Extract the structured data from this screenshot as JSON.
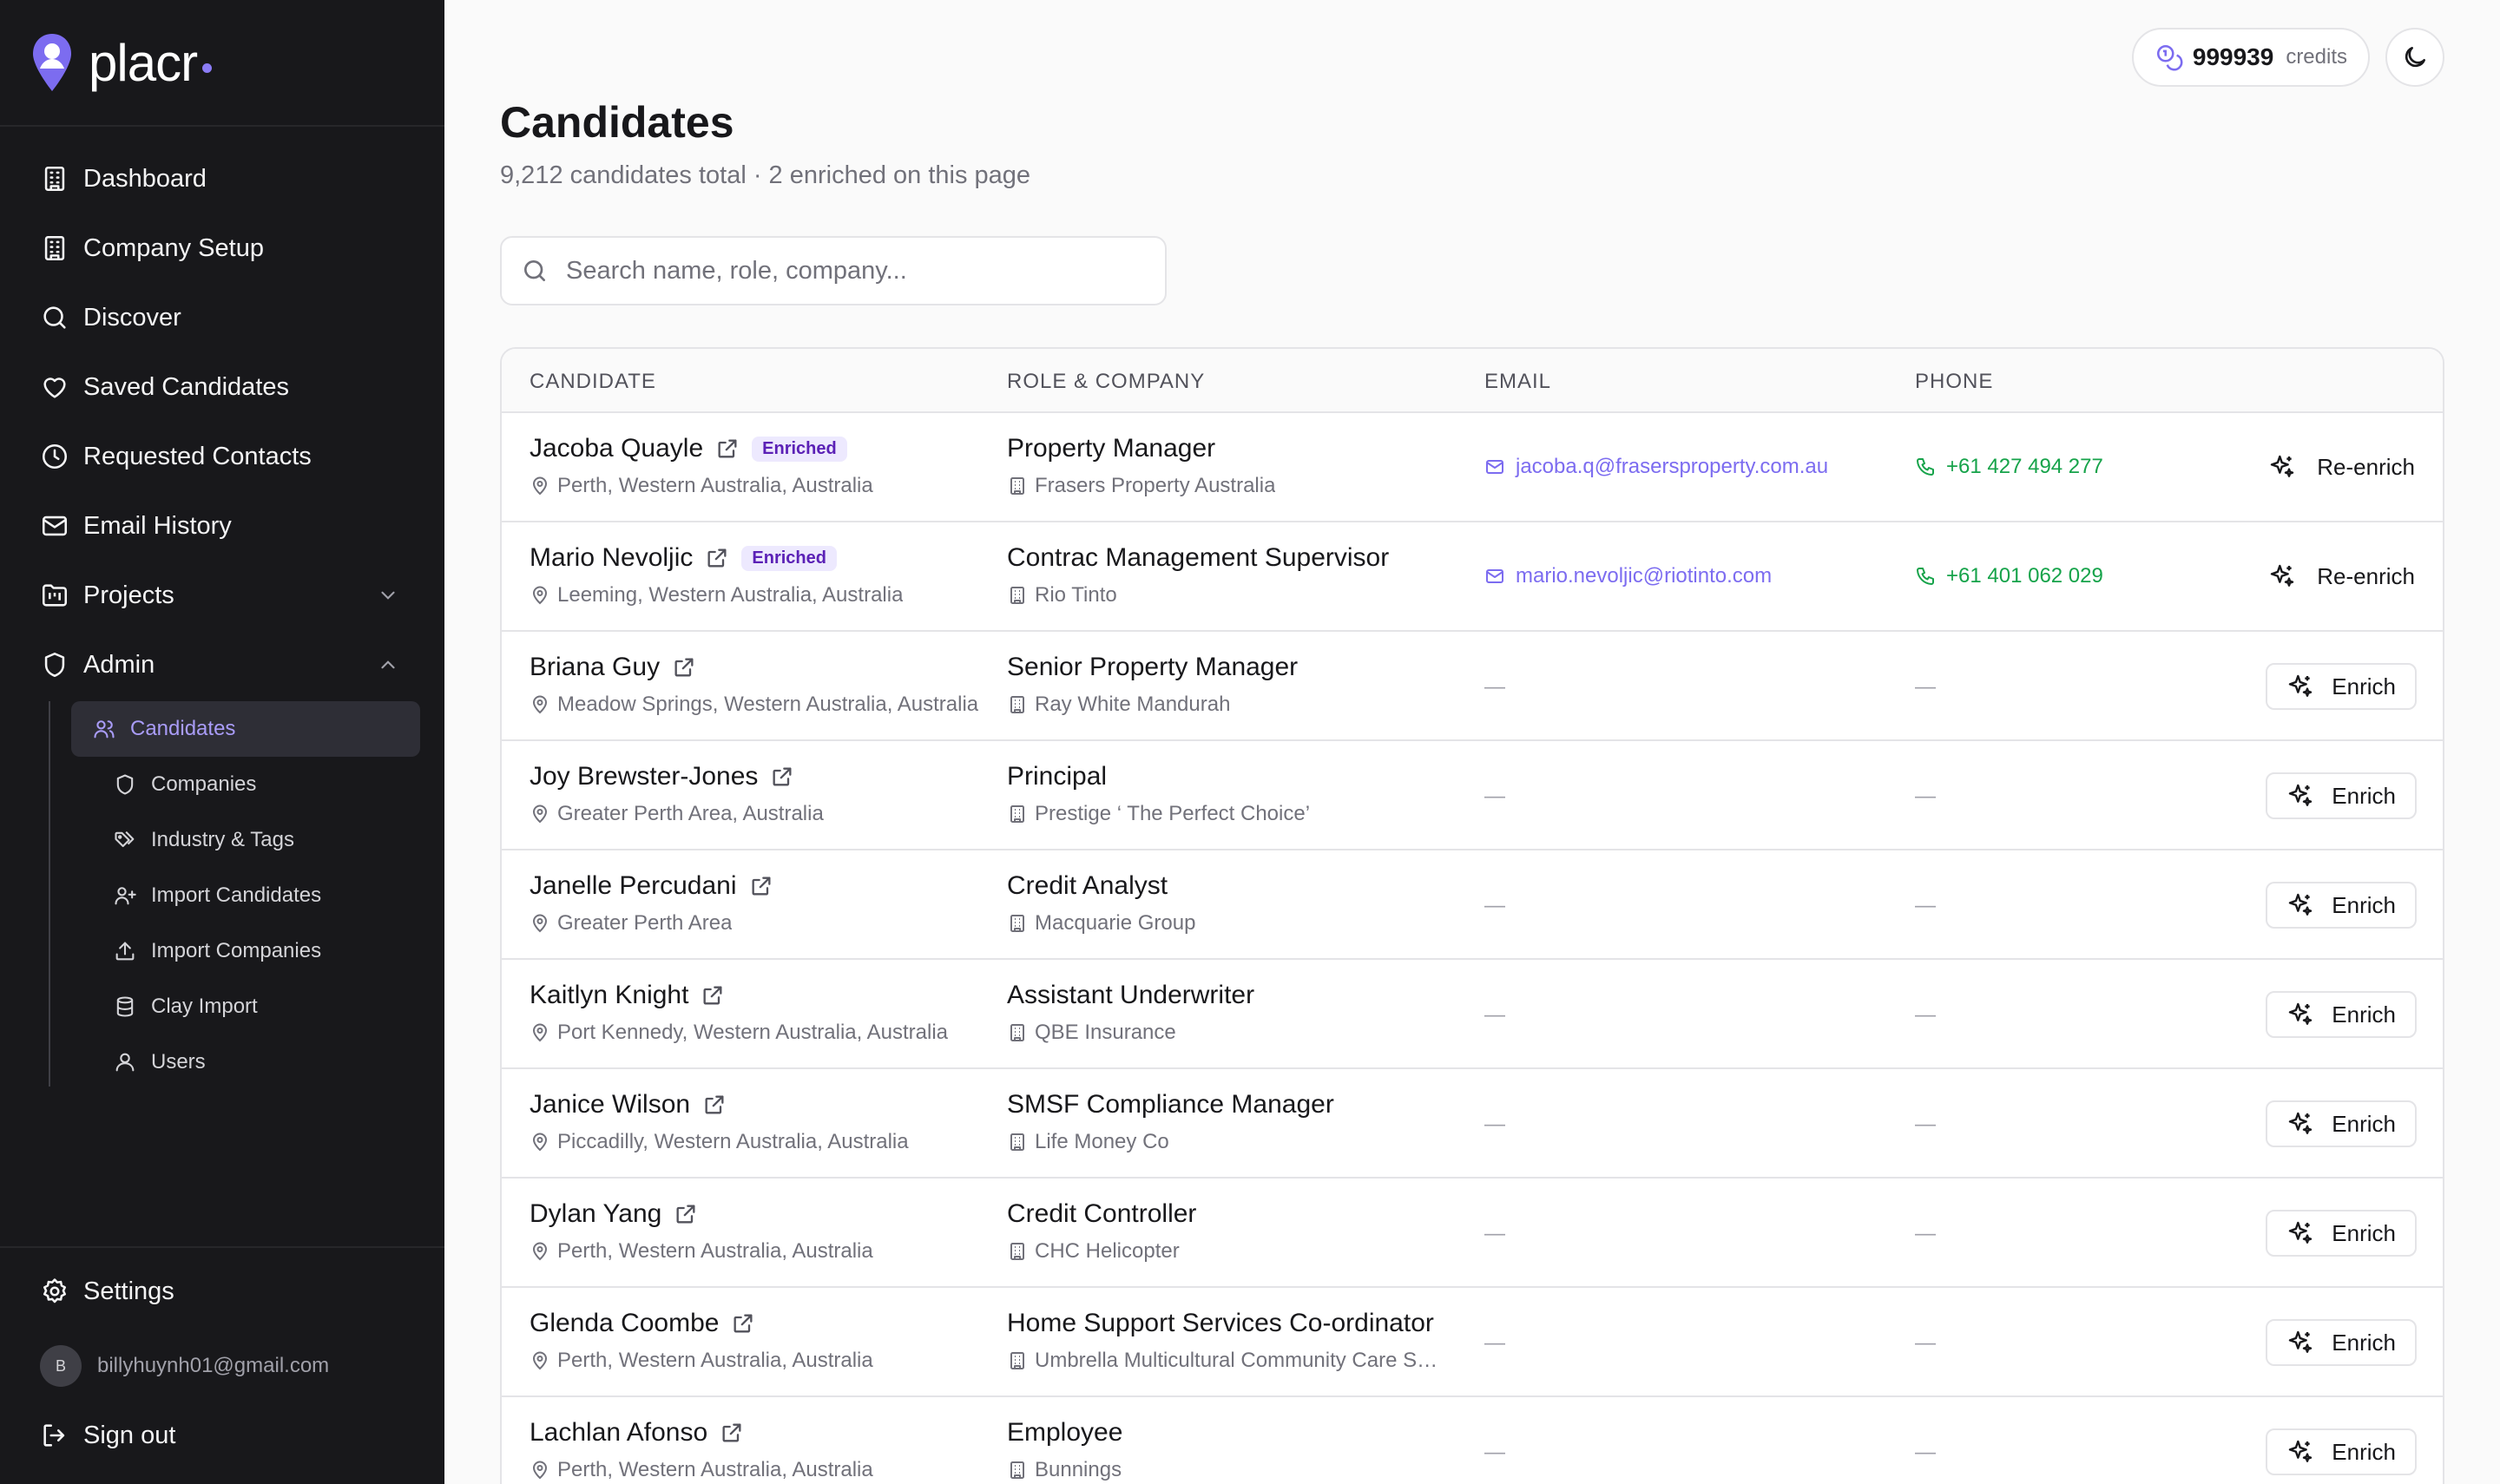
{
  "brand": {
    "name": "placr"
  },
  "sidebar": {
    "items": [
      {
        "label": "Dashboard",
        "icon": "building-icon"
      },
      {
        "label": "Company Setup",
        "icon": "building-icon"
      },
      {
        "label": "Discover",
        "icon": "search-icon"
      },
      {
        "label": "Saved Candidates",
        "icon": "heart-icon"
      },
      {
        "label": "Requested Contacts",
        "icon": "clock-icon"
      },
      {
        "label": "Email History",
        "icon": "mail-icon"
      },
      {
        "label": "Projects",
        "icon": "folder-kanban-icon",
        "expanded": false
      },
      {
        "label": "Admin",
        "icon": "shield-icon",
        "expanded": true
      }
    ],
    "admin_items": [
      {
        "label": "Candidates",
        "icon": "users-icon",
        "active": true
      },
      {
        "label": "Companies",
        "icon": "shield-icon"
      },
      {
        "label": "Industry & Tags",
        "icon": "tags-icon"
      },
      {
        "label": "Import Candidates",
        "icon": "user-plus-icon"
      },
      {
        "label": "Import Companies",
        "icon": "upload-icon"
      },
      {
        "label": "Clay Import",
        "icon": "database-icon"
      },
      {
        "label": "Users",
        "icon": "user-icon"
      }
    ],
    "settings_label": "Settings",
    "user": {
      "avatar_initial": "B",
      "email": "billyhuynh01@gmail.com"
    },
    "signout_label": "Sign out"
  },
  "header": {
    "credits_value": "999939",
    "credits_label": "credits"
  },
  "page": {
    "title": "Candidates",
    "subtitle": "9,212 candidates total · 2 enriched on this page",
    "search_placeholder": "Search name, role, company..."
  },
  "table": {
    "columns": {
      "candidate": "CANDIDATE",
      "role": "ROLE & COMPANY",
      "email": "EMAIL",
      "phone": "PHONE"
    },
    "enriched_badge": "Enriched",
    "empty_dash": "—",
    "reenrich_label": "Re-enrich",
    "enrich_label": "Enrich",
    "rows": [
      {
        "name": "Jacoba Quayle",
        "location": "Perth, Western Australia, Australia",
        "role": "Property Manager",
        "company": "Frasers Property Australia",
        "email": "jacoba.q@frasersproperty.com.au",
        "phone": "+61 427 494 277",
        "enriched": true
      },
      {
        "name": "Mario Nevoljic",
        "location": "Leeming, Western Australia, Australia",
        "role": "Contrac Management Supervisor",
        "company": "Rio Tinto",
        "email": "mario.nevoljic@riotinto.com",
        "phone": "+61 401 062 029",
        "enriched": true
      },
      {
        "name": "Briana Guy",
        "location": "Meadow Springs, Western Australia, Australia",
        "role": "Senior Property Manager",
        "company": "Ray White Mandurah",
        "email": "",
        "phone": "",
        "enriched": false
      },
      {
        "name": "Joy Brewster-Jones",
        "location": "Greater Perth Area, Australia",
        "role": "Principal",
        "company": "Prestige ‘ The Perfect Choice’",
        "email": "",
        "phone": "",
        "enriched": false
      },
      {
        "name": "Janelle Percudani",
        "location": "Greater Perth Area",
        "role": "Credit Analyst",
        "company": "Macquarie Group",
        "email": "",
        "phone": "",
        "enriched": false
      },
      {
        "name": "Kaitlyn Knight",
        "location": "Port Kennedy, Western Australia, Australia",
        "role": "Assistant Underwriter",
        "company": "QBE Insurance",
        "email": "",
        "phone": "",
        "enriched": false
      },
      {
        "name": "Janice Wilson",
        "location": "Piccadilly, Western Australia, Australia",
        "role": "SMSF Compliance Manager",
        "company": "Life Money Co",
        "email": "",
        "phone": "",
        "enriched": false
      },
      {
        "name": "Dylan Yang",
        "location": "Perth, Western Australia, Australia",
        "role": "Credit Controller",
        "company": "CHC Helicopter",
        "email": "",
        "phone": "",
        "enriched": false
      },
      {
        "name": "Glenda Coombe",
        "location": "Perth, Western Australia, Australia",
        "role": "Home Support Services Co-ordinator",
        "company": "Umbrella Multicultural Community Care Services",
        "email": "",
        "phone": "",
        "enriched": false
      },
      {
        "name": "Lachlan Afonso",
        "location": "Perth, Western Australia, Australia",
        "role": "Employee",
        "company": "Bunnings",
        "email": "",
        "phone": "",
        "enriched": false
      }
    ]
  },
  "colors": {
    "accent": "#7c6cf0",
    "phone": "#16a34a",
    "sidebar_bg": "#18181b",
    "badge_bg": "#ede9fe"
  }
}
